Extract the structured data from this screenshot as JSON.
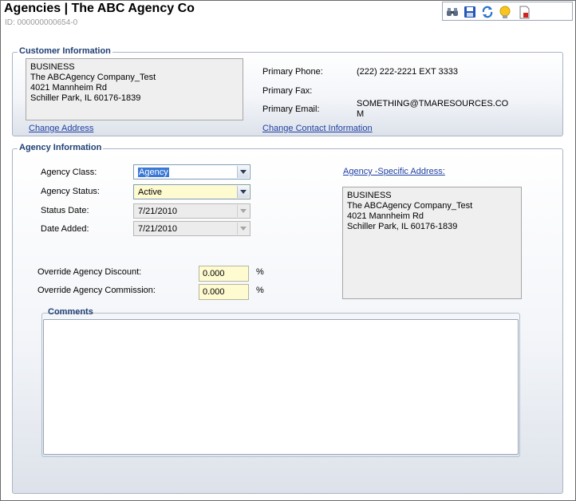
{
  "header": {
    "title": "Agencies  |  The ABC Agency Co",
    "record_id": "ID: 000000000654-0"
  },
  "toolbar": {
    "icons": [
      "binoculars-icon",
      "save-icon",
      "refresh-icon",
      "lightbulb-icon",
      "delete-document-icon"
    ]
  },
  "customer_info": {
    "legend": "Customer Information",
    "address_lines": [
      "BUSINESS",
      "The ABCAgency Company_Test",
      "4021 Mannheim Rd",
      "Schiller Park, IL 60176-1839"
    ],
    "change_address_link": "Change Address",
    "phone_label": "Primary Phone:",
    "phone_value": "(222)  222-2221  EXT 3333",
    "fax_label": "Primary Fax:",
    "fax_value": "",
    "email_label": "Primary Email:",
    "email_value_line1": "SOMETHING@TMARESOURCES.CO",
    "email_value_line2": "M",
    "change_contact_link": "Change Contact Information"
  },
  "agency_info": {
    "legend": "Agency Information",
    "class_label": "Agency Class:",
    "class_value": "Agency",
    "status_label": "Agency Status:",
    "status_value": "Active",
    "status_date_label": "Status Date:",
    "status_date_value": "7/21/2010",
    "date_added_label": "Date Added:",
    "date_added_value": "7/21/2010",
    "override_discount_label": "Override Agency Discount:",
    "override_discount_value": "0.000",
    "override_commission_label": "Override Agency Commission:",
    "override_commission_value": "0.000",
    "percent_symbol": "%",
    "specific_address_link": "Agency -Specific Address:",
    "specific_address_lines": [
      "BUSINESS",
      "The ABCAgency Company_Test",
      "4021 Mannheim Rd",
      "Schiller Park, IL 60176-1839"
    ]
  },
  "comments": {
    "legend": "Comments",
    "value": ""
  }
}
